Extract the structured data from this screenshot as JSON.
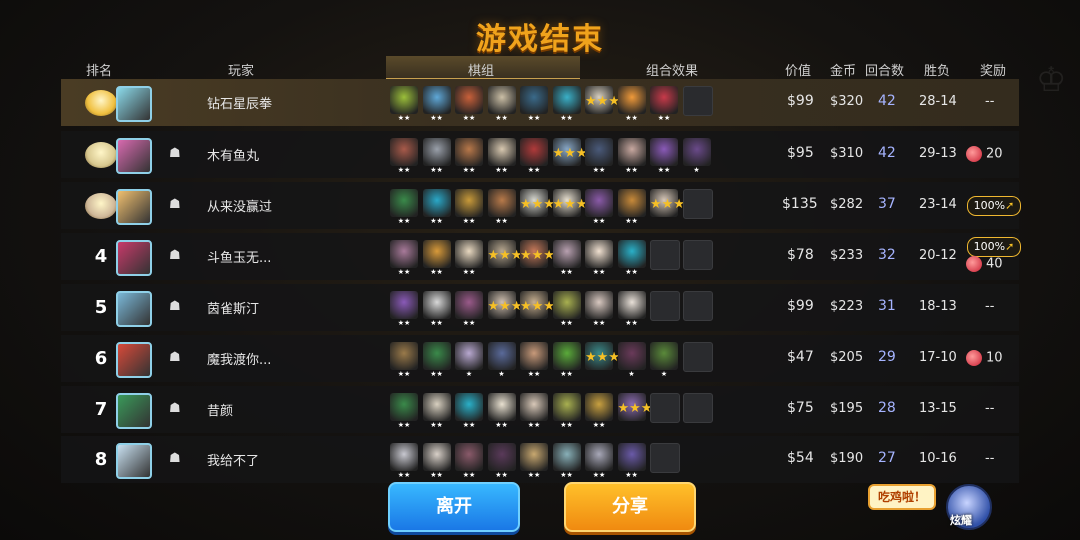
{
  "title": "游戏结束",
  "headers": {
    "rank": "排名",
    "player": "玩家",
    "lineup": "棋组",
    "synergy": "组合效果",
    "value": "价值",
    "gold": "金币",
    "rounds": "回合数",
    "wl": "胜负",
    "reward": "奖励"
  },
  "rows": [
    {
      "rank": "",
      "name": "钻石星辰拳",
      "value": "$99",
      "gold": "$320",
      "rounds": "42",
      "wl": "28-14",
      "reward": "--",
      "pieces": [
        {
          "color": "#9bbf3a",
          "stars": "★★"
        },
        {
          "color": "#5fa8d8",
          "stars": "★★"
        },
        {
          "color": "#c8603a",
          "stars": "★★"
        },
        {
          "color": "#cbbfa6",
          "stars": "★★"
        },
        {
          "color": "#3a6a8a",
          "stars": "★★"
        },
        {
          "color": "#3ab0c8",
          "stars": "★★"
        },
        {
          "color": "#d8d0c0",
          "stars": "★★★"
        },
        {
          "color": "#f09a3a",
          "stars": "★★"
        },
        {
          "color": "#c83a4a",
          "stars": "★★"
        }
      ],
      "empty": 1
    },
    {
      "rank": "",
      "name": "木有鱼丸",
      "value": "$95",
      "gold": "$310",
      "rounds": "42",
      "wl": "29-13",
      "reward": "20",
      "candy": true,
      "pieces": [
        {
          "color": "#a85a4a",
          "stars": "★★"
        },
        {
          "color": "#9aa0aa",
          "stars": "★★"
        },
        {
          "color": "#b8784a",
          "stars": "★★"
        },
        {
          "color": "#d8c8b0",
          "stars": "★★"
        },
        {
          "color": "#b03a3a",
          "stars": "★★"
        },
        {
          "color": "#88a8c8",
          "stars": "★★★"
        },
        {
          "color": "#4a5a7a",
          "stars": "★★"
        },
        {
          "color": "#c8a8a0",
          "stars": "★★"
        },
        {
          "color": "#8a5ab8",
          "stars": "★★"
        },
        {
          "color": "#6a4a8a",
          "stars": "★"
        }
      ],
      "empty": 0
    },
    {
      "rank": "",
      "name": "从来没赢过",
      "value": "$135",
      "gold": "$282",
      "rounds": "37",
      "wl": "23-14",
      "reward": "",
      "badge": "100%",
      "pieces": [
        {
          "color": "#3a8a4a",
          "stars": "★★"
        },
        {
          "color": "#2aa8c8",
          "stars": "★★"
        },
        {
          "color": "#c89a3a",
          "stars": "★★"
        },
        {
          "color": "#b87a4a",
          "stars": "★★"
        },
        {
          "color": "#d8d8d0",
          "stars": "★★★"
        },
        {
          "color": "#e8e0d0",
          "stars": "★★★"
        },
        {
          "color": "#8a5aa8",
          "stars": "★★"
        },
        {
          "color": "#c88a3a",
          "stars": "★★"
        },
        {
          "color": "#d8c8b8",
          "stars": "★★★"
        }
      ],
      "empty": 1
    },
    {
      "rank": "4",
      "name": "斗鱼玉无...",
      "value": "$78",
      "gold": "$233",
      "rounds": "32",
      "wl": "20-12",
      "reward": "40",
      "badge": "100%",
      "candy": true,
      "pieces": [
        {
          "color": "#a87a9a",
          "stars": "★★"
        },
        {
          "color": "#d89a3a",
          "stars": "★★"
        },
        {
          "color": "#e8d8c0",
          "stars": "★★"
        },
        {
          "color": "#b8a890",
          "stars": "★★★"
        },
        {
          "color": "#c87a5a",
          "stars": "★★★"
        },
        {
          "color": "#b8a0b0",
          "stars": "★★"
        },
        {
          "color": "#f0e0d0",
          "stars": "★★"
        },
        {
          "color": "#2ab0c8",
          "stars": "★★"
        }
      ],
      "empty": 2
    },
    {
      "rank": "5",
      "name": "茵雀斯汀",
      "value": "$99",
      "gold": "$223",
      "rounds": "31",
      "wl": "18-13",
      "reward": "--",
      "pieces": [
        {
          "color": "#8a5ab8",
          "stars": "★★"
        },
        {
          "color": "#d8d8d8",
          "stars": "★★"
        },
        {
          "color": "#9a5a8a",
          "stars": "★★"
        },
        {
          "color": "#d0c0b0",
          "stars": "★★★"
        },
        {
          "color": "#c8b090",
          "stars": "★★★"
        },
        {
          "color": "#a8b050",
          "stars": "★★"
        },
        {
          "color": "#d8c8c0",
          "stars": "★★"
        },
        {
          "color": "#e8e0d8",
          "stars": "★★"
        }
      ],
      "empty": 2
    },
    {
      "rank": "6",
      "name": "魔我渡你...",
      "value": "$47",
      "gold": "$205",
      "rounds": "29",
      "wl": "17-10",
      "reward": "10",
      "candy": true,
      "pieces": [
        {
          "color": "#9a7a4a",
          "stars": "★★"
        },
        {
          "color": "#3a8a4a",
          "stars": "★★"
        },
        {
          "color": "#b8a8d0",
          "stars": "★"
        },
        {
          "color": "#5a6a9a",
          "stars": "★"
        },
        {
          "color": "#c89a7a",
          "stars": "★★"
        },
        {
          "color": "#5aaa3a",
          "stars": "★★"
        },
        {
          "color": "#3a8a8a",
          "stars": "★★★"
        },
        {
          "color": "#6a3a5a",
          "stars": "★"
        },
        {
          "color": "#5a8a3a",
          "stars": "★"
        }
      ],
      "empty": 1
    },
    {
      "rank": "7",
      "name": "昔颜",
      "value": "$75",
      "gold": "$195",
      "rounds": "28",
      "wl": "13-15",
      "reward": "--",
      "pieces": [
        {
          "color": "#3a8a4a",
          "stars": "★★"
        },
        {
          "color": "#d8d0c0",
          "stars": "★★"
        },
        {
          "color": "#2ab0c8",
          "stars": "★★"
        },
        {
          "color": "#e8e0d0",
          "stars": "★★"
        },
        {
          "color": "#d8c8b8",
          "stars": "★★"
        },
        {
          "color": "#a8b050",
          "stars": "★★"
        },
        {
          "color": "#c8a040",
          "stars": "★★"
        },
        {
          "color": "#8a6ab0",
          "stars": "★★★"
        }
      ],
      "empty": 2
    },
    {
      "rank": "8",
      "name": "我给不了",
      "value": "$54",
      "gold": "$190",
      "rounds": "27",
      "wl": "10-16",
      "reward": "--",
      "pieces": [
        {
          "color": "#c8c8d0",
          "stars": "★★"
        },
        {
          "color": "#d8d0c8",
          "stars": "★★"
        },
        {
          "color": "#8a5a6a",
          "stars": "★★"
        },
        {
          "color": "#5a3a5a",
          "stars": "★★"
        },
        {
          "color": "#c8a870",
          "stars": "★★"
        },
        {
          "color": "#88b0b8",
          "stars": "★★"
        },
        {
          "color": "#a8a8b8",
          "stars": "★★"
        },
        {
          "color": "#6a5aa8",
          "stars": "★★"
        }
      ],
      "empty": 1
    }
  ],
  "buttons": {
    "leave": "离开",
    "share": "分享"
  },
  "bubble": "吃鸡啦！",
  "mascot_label": "炫耀",
  "colors": {
    "accent": "#f0a31c",
    "rounds": "#a6b4ff"
  }
}
